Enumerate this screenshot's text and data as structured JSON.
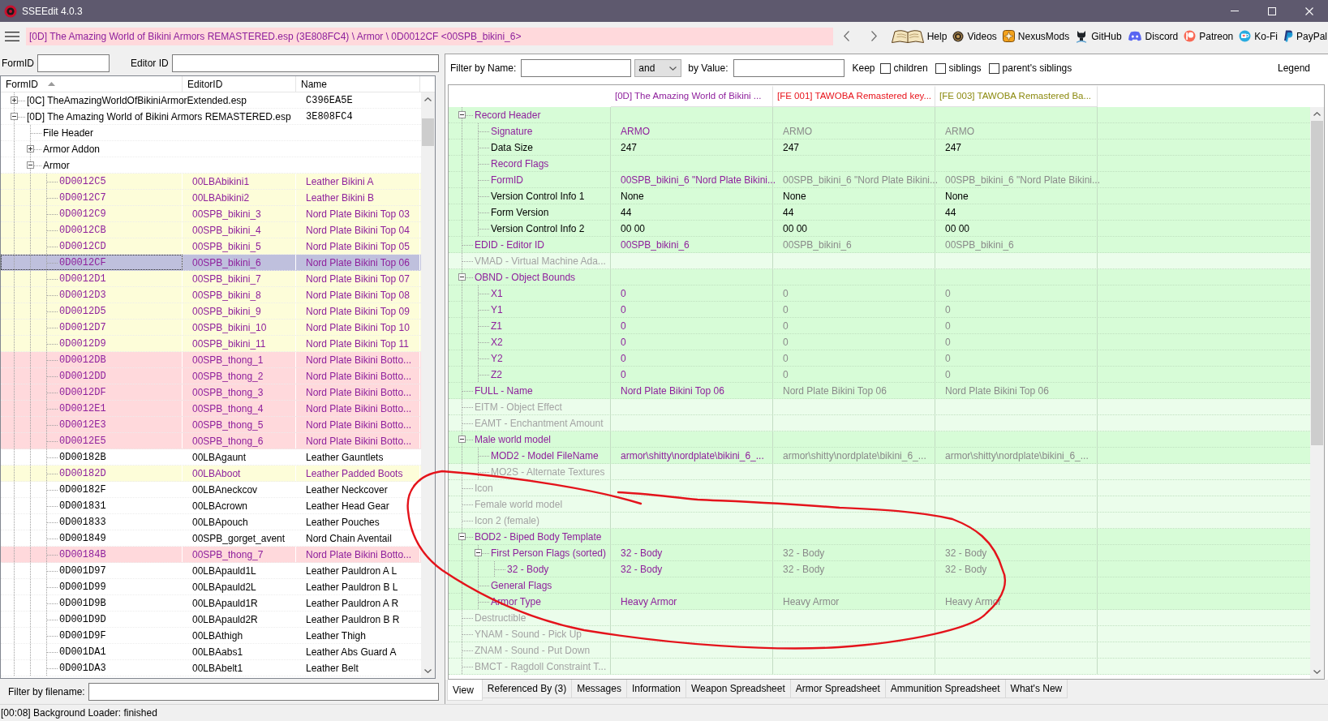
{
  "window": {
    "title": "SSEEdit 4.0.3"
  },
  "toolbar": {
    "path": "[0D] The Amazing World of Bikini Armors REMASTERED.esp (3E808FC4) \\ Armor \\ 0D0012CF <00SPB_bikini_6>",
    "links": [
      "Help",
      "Videos",
      "NexusMods",
      "GitHub",
      "Discord",
      "Patreon",
      "Ko-Fi",
      "PayPal"
    ]
  },
  "record_filter": {
    "form_id_label": "FormID",
    "editor_id_label": "Editor ID"
  },
  "plugin_tree": {
    "columns": [
      {
        "label": "FormID",
        "sorted": true
      },
      {
        "label": "EditorID",
        "sorted": false
      },
      {
        "label": "Name",
        "sorted": false
      }
    ],
    "nodes": [
      {
        "kind": "plugin",
        "label": "[0C] TheAmazingWorldOfBikiniArmorExtended.esp",
        "name": "C396EA5E",
        "expanded": false,
        "selected": false
      },
      {
        "kind": "plugin",
        "label": "[0D] The Amazing World of Bikini Armors REMASTERED.esp",
        "name": "3E808FC4",
        "expanded": true,
        "selected": false,
        "children": [
          {
            "kind": "group",
            "label": "File Header",
            "selected": false
          },
          {
            "kind": "group",
            "label": "Armor Addon",
            "expanded": false,
            "selected": false
          },
          {
            "kind": "group",
            "label": "Armor",
            "expanded": true,
            "selected": false,
            "children": [
              {
                "kind": "record",
                "form_id": "0D0012C5",
                "editor_id": "00LBAbikini1",
                "name": "Leather Bikini A",
                "overridden": true,
                "conflict": false,
                "selected": false
              },
              {
                "kind": "record",
                "form_id": "0D0012C7",
                "editor_id": "00LBAbikini2",
                "name": "Leather Bikini B",
                "overridden": true,
                "conflict": false,
                "selected": false
              },
              {
                "kind": "record",
                "form_id": "0D0012C9",
                "editor_id": "00SPB_bikini_3",
                "name": "Nord Plate Bikini Top 03",
                "overridden": true,
                "conflict": false,
                "selected": false
              },
              {
                "kind": "record",
                "form_id": "0D0012CB",
                "editor_id": "00SPB_bikini_4",
                "name": "Nord Plate Bikini Top 04",
                "overridden": true,
                "conflict": false,
                "selected": false
              },
              {
                "kind": "record",
                "form_id": "0D0012CD",
                "editor_id": "00SPB_bikini_5",
                "name": "Nord Plate Bikini Top 05",
                "overridden": true,
                "conflict": false,
                "selected": false
              },
              {
                "kind": "record",
                "form_id": "0D0012CF",
                "editor_id": "00SPB_bikini_6",
                "name": "Nord Plate Bikini Top 06",
                "overridden": true,
                "selected": true
              },
              {
                "kind": "record",
                "form_id": "0D0012D1",
                "editor_id": "00SPB_bikini_7",
                "name": "Nord Plate Bikini Top 07",
                "overridden": true,
                "conflict": false,
                "selected": false
              },
              {
                "kind": "record",
                "form_id": "0D0012D3",
                "editor_id": "00SPB_bikini_8",
                "name": "Nord Plate Bikini Top 08",
                "overridden": true,
                "conflict": false,
                "selected": false
              },
              {
                "kind": "record",
                "form_id": "0D0012D5",
                "editor_id": "00SPB_bikini_9",
                "name": "Nord Plate Bikini Top 09",
                "overridden": true,
                "conflict": false,
                "selected": false
              },
              {
                "kind": "record",
                "form_id": "0D0012D7",
                "editor_id": "00SPB_bikini_10",
                "name": "Nord Plate Bikini Top 10",
                "overridden": true,
                "conflict": false,
                "selected": false
              },
              {
                "kind": "record",
                "form_id": "0D0012D9",
                "editor_id": "00SPB_bikini_11",
                "name": "Nord Plate Bikini Top 11",
                "overridden": true,
                "conflict": false,
                "selected": false
              },
              {
                "kind": "record",
                "form_id": "0D0012DB",
                "editor_id": "00SPB_thong_1",
                "name": "Nord Plate Bikini Botto...",
                "overridden": true,
                "conflict": true,
                "selected": false
              },
              {
                "kind": "record",
                "form_id": "0D0012DD",
                "editor_id": "00SPB_thong_2",
                "name": "Nord Plate Bikini Botto...",
                "overridden": true,
                "conflict": true,
                "selected": false
              },
              {
                "kind": "record",
                "form_id": "0D0012DF",
                "editor_id": "00SPB_thong_3",
                "name": "Nord Plate Bikini Botto...",
                "overridden": true,
                "conflict": true,
                "selected": false
              },
              {
                "kind": "record",
                "form_id": "0D0012E1",
                "editor_id": "00SPB_thong_4",
                "name": "Nord Plate Bikini Botto...",
                "overridden": true,
                "conflict": true,
                "selected": false
              },
              {
                "kind": "record",
                "form_id": "0D0012E3",
                "editor_id": "00SPB_thong_5",
                "name": "Nord Plate Bikini Botto...",
                "overridden": true,
                "conflict": true,
                "selected": false
              },
              {
                "kind": "record",
                "form_id": "0D0012E5",
                "editor_id": "00SPB_thong_6",
                "name": "Nord Plate Bikini Botto...",
                "overridden": true,
                "conflict": true,
                "selected": false
              },
              {
                "kind": "record",
                "form_id": "0D00182B",
                "editor_id": "00LBAgaunt",
                "name": "Leather Gauntlets",
                "overridden": false,
                "conflict": false,
                "selected": false
              },
              {
                "kind": "record",
                "form_id": "0D00182D",
                "editor_id": "00LBAboot",
                "name": "Leather Padded Boots",
                "overridden": true,
                "conflict": false,
                "selected": false
              },
              {
                "kind": "record",
                "form_id": "0D00182F",
                "editor_id": "00LBAneckcov",
                "name": "Leather Neckcover",
                "overridden": false,
                "conflict": false,
                "selected": false
              },
              {
                "kind": "record",
                "form_id": "0D001831",
                "editor_id": "00LBAcrown",
                "name": "Leather Head Gear",
                "overridden": false,
                "conflict": false,
                "selected": false
              },
              {
                "kind": "record",
                "form_id": "0D001833",
                "editor_id": "00LBApouch",
                "name": "Leather Pouches",
                "overridden": false,
                "conflict": false,
                "selected": false
              },
              {
                "kind": "record",
                "form_id": "0D001849",
                "editor_id": "00SPB_gorget_avent",
                "name": "Nord Chain Aventail",
                "overridden": false,
                "conflict": false,
                "selected": false
              },
              {
                "kind": "record",
                "form_id": "0D00184B",
                "editor_id": "00SPB_thong_7",
                "name": "Nord Plate Bikini Botto...",
                "overridden": true,
                "conflict": true,
                "selected": false
              },
              {
                "kind": "record",
                "form_id": "0D001D97",
                "editor_id": "00LBApauld1L",
                "name": "Leather Pauldron A L",
                "overridden": false,
                "conflict": false,
                "selected": false
              },
              {
                "kind": "record",
                "form_id": "0D001D99",
                "editor_id": "00LBApauld2L",
                "name": "Leather Pauldron B L",
                "overridden": false,
                "conflict": false,
                "selected": false
              },
              {
                "kind": "record",
                "form_id": "0D001D9B",
                "editor_id": "00LBApauld1R",
                "name": "Leather Pauldron A R",
                "overridden": false,
                "conflict": false,
                "selected": false
              },
              {
                "kind": "record",
                "form_id": "0D001D9D",
                "editor_id": "00LBApauld2R",
                "name": "Leather Pauldron B R",
                "overridden": false,
                "conflict": false,
                "selected": false
              },
              {
                "kind": "record",
                "form_id": "0D001D9F",
                "editor_id": "00LBAthigh",
                "name": "Leather Thigh",
                "overridden": false,
                "conflict": false,
                "selected": false
              },
              {
                "kind": "record",
                "form_id": "0D001DA1",
                "editor_id": "00LBAabs1",
                "name": "Leather Abs Guard A",
                "overridden": false,
                "conflict": false,
                "selected": false
              },
              {
                "kind": "record",
                "form_id": "0D001DA3",
                "editor_id": "00LBAbelt1",
                "name": "Leather Belt",
                "overridden": false,
                "conflict": false,
                "selected": false
              }
            ]
          }
        ]
      }
    ]
  },
  "filename_filter": {
    "label": "Filter by filename:"
  },
  "view_filter": {
    "name_label": "Filter by Name:",
    "operator": "and",
    "value_label": "by Value:",
    "keep_label": "Keep",
    "keep_options": [
      {
        "label": "children",
        "checked": false
      },
      {
        "label": "siblings",
        "checked": false
      },
      {
        "label": "parent's siblings",
        "checked": false
      }
    ],
    "legend": "Legend"
  },
  "record_view": {
    "columns": [
      {
        "label": "[0D] The Amazing World of Bikini ...",
        "color": "#8e1f9c"
      },
      {
        "label": "[FE 001] TAWOBA Remastered key...",
        "color": "#e8141c"
      },
      {
        "label": "[FE 003] TAWOBA Remastered Ba...",
        "color": "#8c8a10"
      }
    ],
    "rows": [
      {
        "label": "Record Header",
        "overridden": true,
        "empty": false,
        "expanded": true,
        "children": [
          {
            "label": "Signature",
            "overridden": true,
            "empty": false,
            "values": [
              "ARMO",
              "ARMO",
              "ARMO"
            ]
          },
          {
            "label": "Data Size",
            "overridden": false,
            "empty": false,
            "values": [
              "247",
              "247",
              "247"
            ]
          },
          {
            "label": "Record Flags",
            "overridden": true,
            "empty": false
          },
          {
            "label": "FormID",
            "overridden": true,
            "empty": false,
            "values": [
              "00SPB_bikini_6 \"Nord Plate Bikini...",
              "00SPB_bikini_6 \"Nord Plate Bikini...",
              "00SPB_bikini_6 \"Nord Plate Bikini..."
            ]
          },
          {
            "label": "Version Control Info 1",
            "overridden": false,
            "empty": false,
            "values": [
              "None",
              "None",
              "None"
            ]
          },
          {
            "label": "Form Version",
            "overridden": false,
            "empty": false,
            "values": [
              "44",
              "44",
              "44"
            ]
          },
          {
            "label": "Version Control Info 2",
            "overridden": false,
            "empty": false,
            "values": [
              "00 00",
              "00 00",
              "00 00"
            ]
          }
        ]
      },
      {
        "label": "EDID - Editor ID",
        "overridden": true,
        "empty": false,
        "values": [
          "00SPB_bikini_6",
          "00SPB_bikini_6",
          "00SPB_bikini_6"
        ]
      },
      {
        "label": "VMAD - Virtual Machine Ada...",
        "empty": true
      },
      {
        "label": "OBND - Object Bounds",
        "overridden": true,
        "empty": false,
        "expanded": true,
        "children": [
          {
            "label": "X1",
            "overridden": true,
            "empty": false,
            "values": [
              "0",
              "0",
              "0"
            ]
          },
          {
            "label": "Y1",
            "overridden": true,
            "empty": false,
            "values": [
              "0",
              "0",
              "0"
            ]
          },
          {
            "label": "Z1",
            "overridden": true,
            "empty": false,
            "values": [
              "0",
              "0",
              "0"
            ]
          },
          {
            "label": "X2",
            "overridden": true,
            "empty": false,
            "values": [
              "0",
              "0",
              "0"
            ]
          },
          {
            "label": "Y2",
            "overridden": true,
            "empty": false,
            "values": [
              "0",
              "0",
              "0"
            ]
          },
          {
            "label": "Z2",
            "overridden": true,
            "empty": false,
            "values": [
              "0",
              "0",
              "0"
            ]
          }
        ]
      },
      {
        "label": "FULL - Name",
        "overridden": true,
        "empty": false,
        "values": [
          "Nord Plate Bikini Top 06",
          "Nord Plate Bikini Top 06",
          "Nord Plate Bikini Top 06"
        ]
      },
      {
        "label": "EITM - Object Effect",
        "empty": true
      },
      {
        "label": "EAMT - Enchantment Amount",
        "empty": true
      },
      {
        "label": "Male world model",
        "overridden": true,
        "empty": false,
        "expanded": true,
        "children": [
          {
            "label": "MOD2 - Model FileName",
            "overridden": true,
            "empty": false,
            "values": [
              "armor\\shitty\\nordplate\\bikini_6_...",
              "armor\\shitty\\nordplate\\bikini_6_...",
              "armor\\shitty\\nordplate\\bikini_6_..."
            ]
          },
          {
            "label": "MO2S - Alternate Textures",
            "empty": true
          }
        ]
      },
      {
        "label": "Icon",
        "empty": true
      },
      {
        "label": "Female world model",
        "empty": true
      },
      {
        "label": "Icon 2 (female)",
        "empty": true
      },
      {
        "label": "BOD2 - Biped Body Template",
        "overridden": true,
        "empty": false,
        "expanded": true,
        "children": [
          {
            "label": "First Person Flags (sorted)",
            "overridden": true,
            "empty": false,
            "expanded": true,
            "values": [
              "32 - Body",
              "32 - Body",
              "32 - Body"
            ],
            "children": [
              {
                "label": "32 - Body",
                "overridden": true,
                "empty": false,
                "values": [
                  "32 - Body",
                  "32 - Body",
                  "32 - Body"
                ]
              }
            ]
          },
          {
            "label": "General Flags",
            "overridden": true,
            "empty": false
          },
          {
            "label": "Armor Type",
            "overridden": true,
            "empty": false,
            "values": [
              "Heavy Armor",
              "Heavy Armor",
              "Heavy Armor"
            ]
          }
        ]
      },
      {
        "label": "Destructible",
        "empty": true
      },
      {
        "label": "YNAM - Sound - Pick Up",
        "empty": true
      },
      {
        "label": "ZNAM - Sound - Put Down",
        "empty": true
      },
      {
        "label": "BMCT - Ragdoll Constraint T...",
        "empty": true
      }
    ]
  },
  "view_tabs": [
    {
      "label": "View",
      "selected": true
    },
    {
      "label": "Referenced By (3)",
      "selected": false
    },
    {
      "label": "Messages",
      "selected": false
    },
    {
      "label": "Information",
      "selected": false
    },
    {
      "label": "Weapon Spreadsheet",
      "selected": false
    },
    {
      "label": "Armor Spreadsheet",
      "selected": false
    },
    {
      "label": "Ammunition Spreadsheet",
      "selected": false
    },
    {
      "label": "What's New",
      "selected": false
    }
  ],
  "status_bar": {
    "text": "[00:08] Background Loader: finished"
  },
  "annotations": [
    {
      "kind": "freehand_loop"
    }
  ]
}
